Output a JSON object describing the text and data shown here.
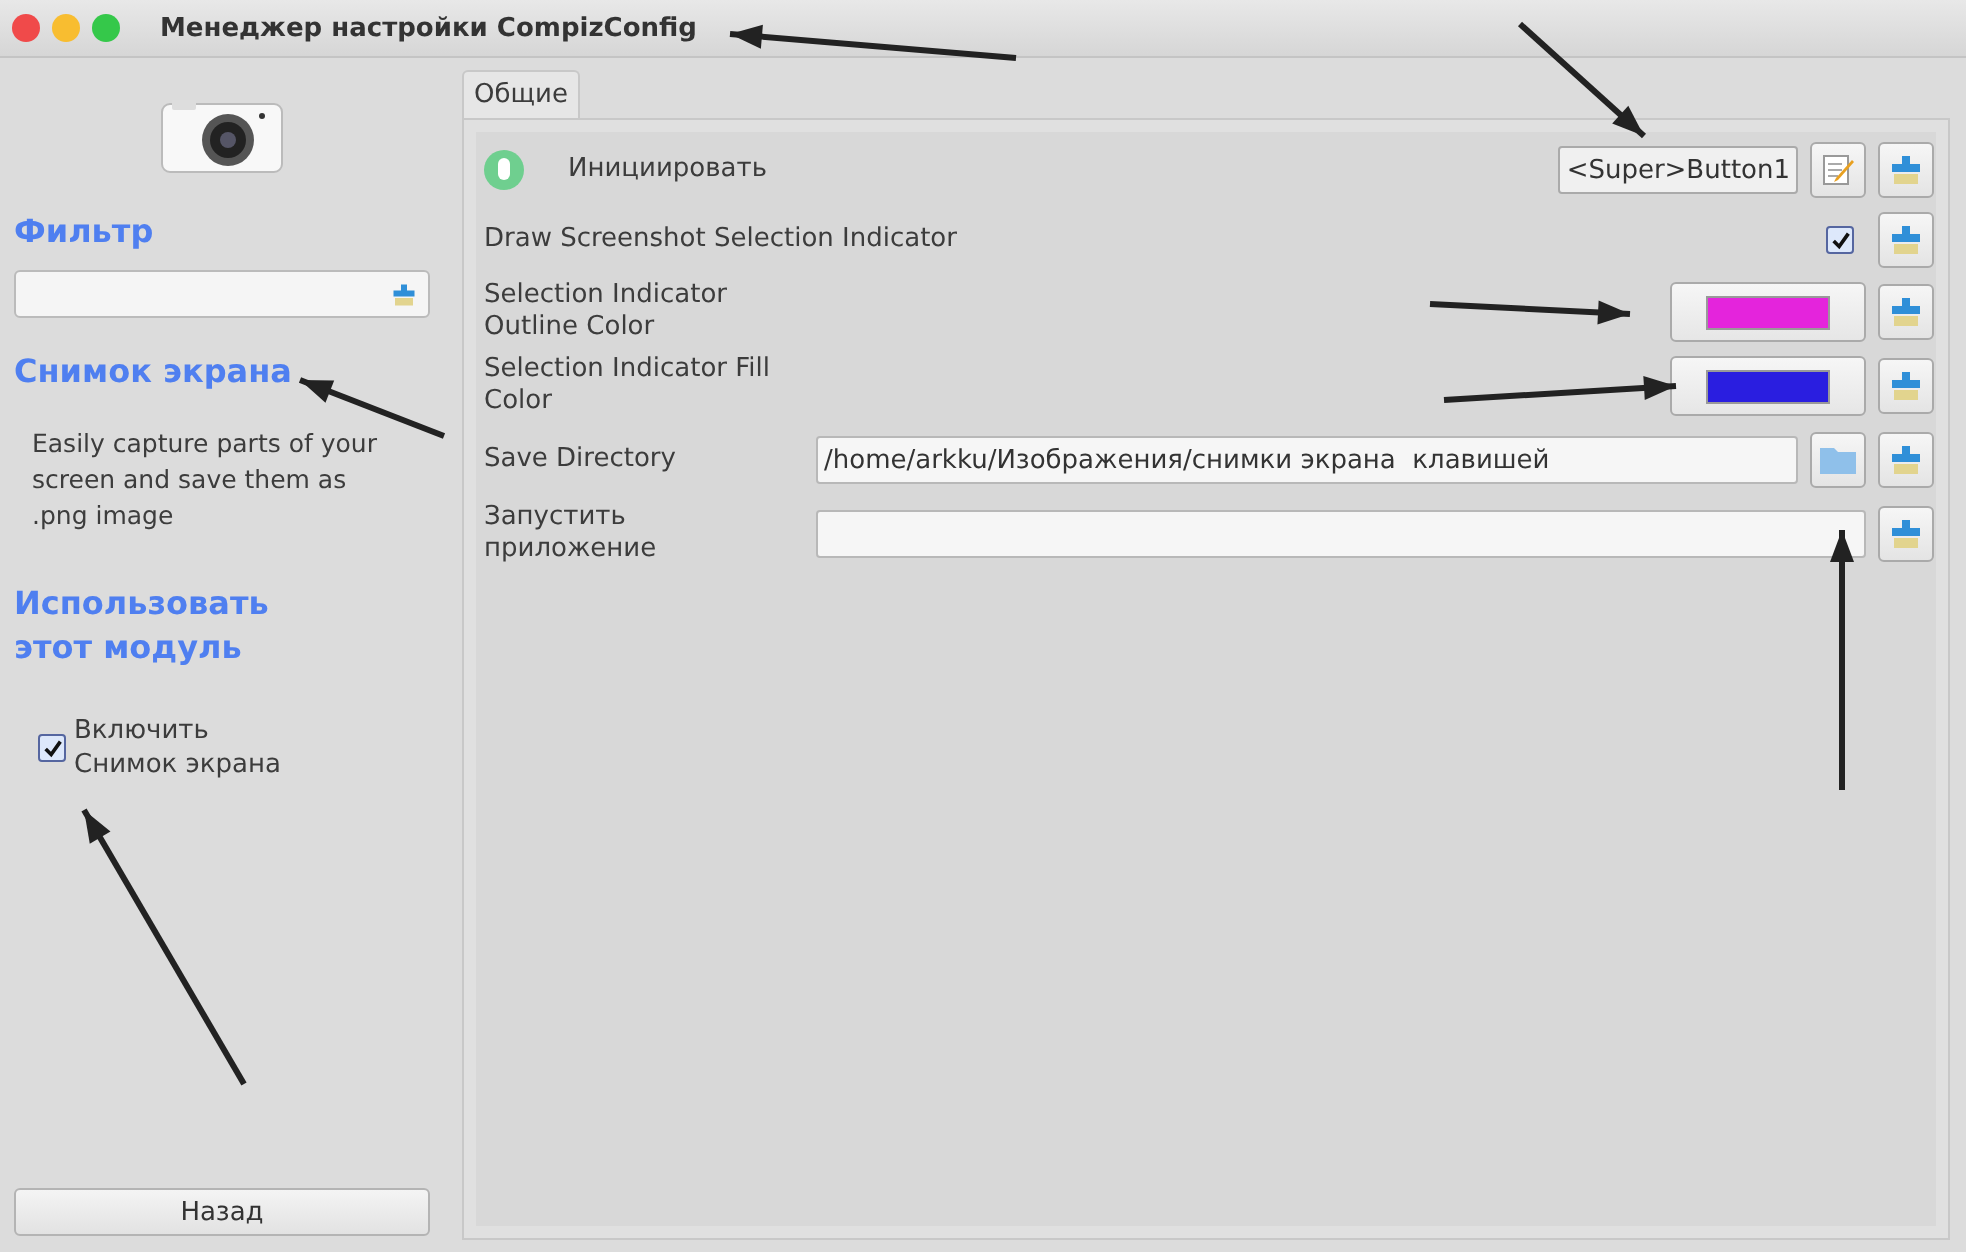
{
  "window": {
    "title": "Менеджер настройки CompizConfig"
  },
  "sidebar": {
    "filter": {
      "heading": "Фильтр"
    },
    "plugin": {
      "name": "Снимок экрана",
      "description": "Easily capture parts of your screen and save them as .png image"
    },
    "use": {
      "heading": "Использовать этот модуль",
      "checkbox": {
        "label": "Включить Снимок экрана",
        "checked": true
      }
    },
    "back_button": "Назад"
  },
  "tabs": [
    {
      "label": "Общие",
      "selected": true
    }
  ],
  "settings": [
    {
      "kind": "shortcut",
      "label": "Инициировать",
      "value": "<Super>Button1"
    },
    {
      "kind": "checkbox",
      "label": "Draw Screenshot Selection Indicator",
      "checked": true
    },
    {
      "kind": "color",
      "label": "Selection Indicator Outline Color",
      "color": "#e424dc"
    },
    {
      "kind": "color",
      "label": "Selection Indicator Fill Color",
      "color": "#2a1ee0"
    },
    {
      "kind": "path",
      "label": "Save Directory",
      "value": "/home/arkku/Изображения/снимки экрана  клавишей"
    },
    {
      "kind": "text",
      "label": "Запустить приложение"
    }
  ]
}
